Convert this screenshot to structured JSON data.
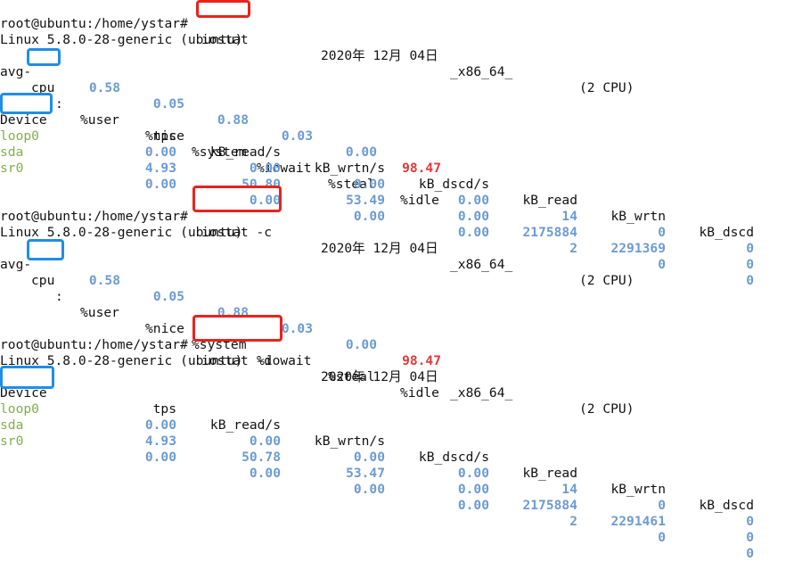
{
  "prompt": "root@ubuntu:/home/ystar#",
  "sysinfo": {
    "kernel": "Linux 5.8.0-28-generic (ubuntu)",
    "date": "2020年 12月 04日",
    "arch": "_x86_64_",
    "cpus": "(2 CPU)"
  },
  "blocks": [
    {
      "command": "iostat",
      "cpu": {
        "label_pre": "avg-",
        "label_cpu": "cpu",
        "label_post": ":",
        "headers": [
          "%user",
          "%nice",
          "%system",
          "%iowait",
          "%steal",
          "%idle"
        ],
        "values": [
          "0.58",
          "0.05",
          "0.88",
          "0.03",
          "0.00",
          "98.47"
        ]
      },
      "device": {
        "label": "Device",
        "headers": [
          "tps",
          "kB_read/s",
          "kB_wrtn/s",
          "kB_dscd/s",
          "kB_read",
          "kB_wrtn",
          "kB_dscd"
        ],
        "rows": [
          {
            "name": "loop0",
            "values": [
              "0.00",
              "0.00",
              "0.00",
              "0.00",
              "14",
              "0",
              "0"
            ]
          },
          {
            "name": "sda",
            "values": [
              "4.93",
              "50.80",
              "53.49",
              "0.00",
              "2175884",
              "2291369",
              "0"
            ]
          },
          {
            "name": "sr0",
            "values": [
              "0.00",
              "0.00",
              "0.00",
              "0.00",
              "2",
              "0",
              "0"
            ]
          }
        ]
      }
    },
    {
      "command": "iostat -c",
      "cpu": {
        "label_pre": "avg-",
        "label_cpu": "cpu",
        "label_post": ":",
        "headers": [
          "%user",
          "%nice",
          "%system",
          "%iowait",
          "%steal",
          "%idle"
        ],
        "values": [
          "0.58",
          "0.05",
          "0.88",
          "0.03",
          "0.00",
          "98.47"
        ]
      }
    },
    {
      "command": "iostat -d",
      "device": {
        "label": "Device",
        "headers": [
          "tps",
          "kB_read/s",
          "kB_wrtn/s",
          "kB_dscd/s",
          "kB_read",
          "kB_wrtn",
          "kB_dscd"
        ],
        "rows": [
          {
            "name": "loop0",
            "values": [
              "0.00",
              "0.00",
              "0.00",
              "0.00",
              "14",
              "0",
              "0"
            ]
          },
          {
            "name": "sda",
            "values": [
              "4.93",
              "50.78",
              "53.47",
              "0.00",
              "2175884",
              "2291461",
              "0"
            ]
          },
          {
            "name": "sr0",
            "values": [
              "0.00",
              "0.00",
              "0.00",
              "0.00",
              "2",
              "0",
              "0"
            ]
          }
        ]
      }
    }
  ],
  "colors": {
    "number": "#6c9bd2",
    "device_name": "#7fb04a",
    "idle_highlight": "#e03a3a",
    "annotation_red": "#e8231c",
    "annotation_blue": "#1f8ee6"
  }
}
